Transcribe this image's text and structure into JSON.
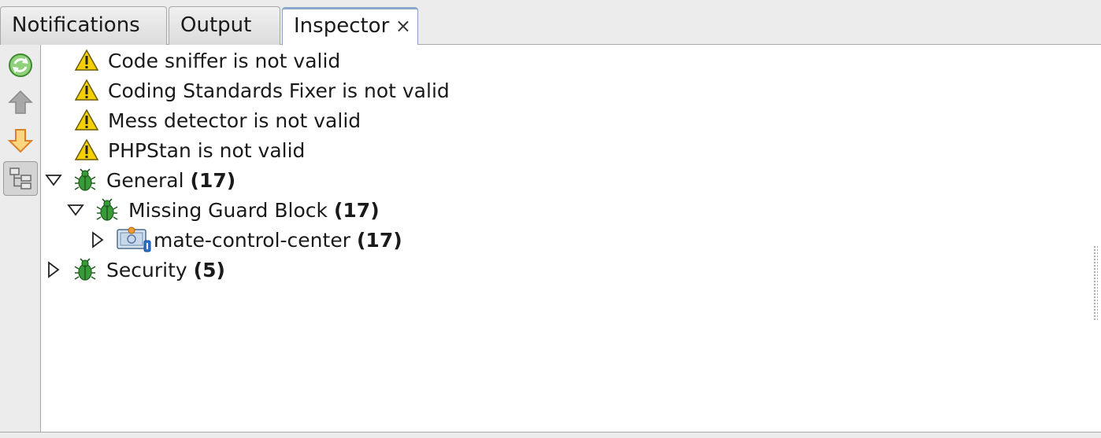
{
  "tabs": [
    {
      "label": "Notifications"
    },
    {
      "label": "Output"
    },
    {
      "label": "Inspector",
      "close": "×"
    }
  ],
  "toolbar": {
    "refresh": "refresh-icon",
    "up": "up-arrow-icon",
    "down": "down-arrow-icon",
    "tree": "tree-view-icon"
  },
  "warnings": [
    {
      "text": "Code sniffer is not valid"
    },
    {
      "text": "Coding Standards Fixer is not valid"
    },
    {
      "text": "Mess detector is not valid"
    },
    {
      "text": "PHPStan is not valid"
    }
  ],
  "tree": {
    "general": {
      "label": "General",
      "count": "(17)"
    },
    "missing_guard": {
      "label": "Missing Guard Block",
      "count": "(17)"
    },
    "project": {
      "label": "mate-control-center",
      "count": "(17)"
    },
    "security": {
      "label": "Security",
      "count": "(5)"
    }
  },
  "colors": {
    "warning": "#f5d000",
    "bug": "#3a9a3a",
    "arrow_down": "#f0a030",
    "arrow_up": "#9a9a9a"
  }
}
